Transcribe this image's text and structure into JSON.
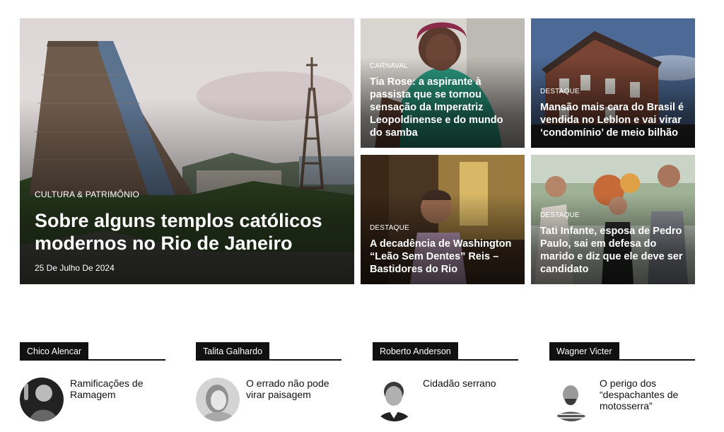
{
  "featured": {
    "kicker": "CULTURA & PATRIMÔNIO",
    "title": "Sobre alguns templos católicos modernos no Rio de Janeiro",
    "date": "25 De Julho De 2024"
  },
  "cards": [
    {
      "kicker": "CARNAVAL",
      "title": "Tia Rose: a aspirante à passista que se tornou sensação da Imperatriz Leopoldinense e do mundo do samba"
    },
    {
      "kicker": "DESTAQUE",
      "title": "Mansão mais cara do Brasil é vendida no Leblon e vai virar ‘condomínio’ de meio bilhão"
    },
    {
      "kicker": "DESTAQUE",
      "title": "A decadência de Washington “Leão Sem Dentes” Reis – Bastidores do Rio"
    },
    {
      "kicker": "DESTAQUE",
      "title": "Tati Infante, esposa de Pedro Paulo, sai em defesa do marido e diz que ele deve ser candidato"
    }
  ],
  "columnists": [
    {
      "name": "Chico Alencar",
      "title": "Ramificações de Ramagem"
    },
    {
      "name": "Talita Galhardo",
      "title": "O errado não pode virar paisagem"
    },
    {
      "name": "Roberto Anderson",
      "title": "Cidadão serrano"
    },
    {
      "name": "Wagner Victer",
      "title": "O perigo dos “despachantes de motosserra”"
    }
  ]
}
